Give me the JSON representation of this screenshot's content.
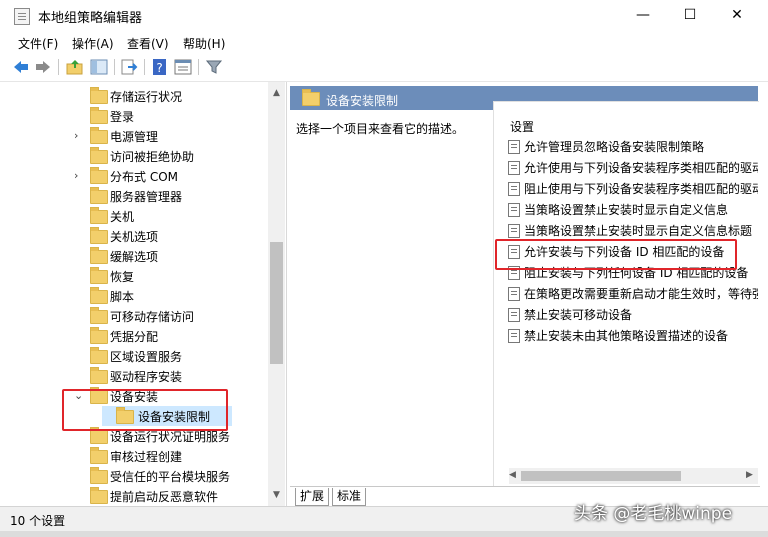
{
  "window": {
    "title": "本地组策略编辑器",
    "minimize": "—",
    "maximize": "☐",
    "close": "✕"
  },
  "menu": [
    "文件(F)",
    "操作(A)",
    "查看(V)",
    "帮助(H)"
  ],
  "toolbar": [
    "back-icon",
    "forward-icon",
    "up-folder-icon",
    "show-tree-icon",
    "export-icon",
    "help-icon",
    "properties-icon",
    "filter-icon"
  ],
  "tree": {
    "items": [
      {
        "label": "存储运行状况",
        "expandable": false
      },
      {
        "label": "登录",
        "expandable": false
      },
      {
        "label": "电源管理",
        "expandable": true
      },
      {
        "label": "访问被拒绝协助",
        "expandable": false
      },
      {
        "label": "分布式 COM",
        "expandable": true
      },
      {
        "label": "服务器管理器",
        "expandable": false
      },
      {
        "label": "关机",
        "expandable": false
      },
      {
        "label": "关机选项",
        "expandable": false
      },
      {
        "label": "缓解选项",
        "expandable": false
      },
      {
        "label": "恢复",
        "expandable": false
      },
      {
        "label": "脚本",
        "expandable": false
      },
      {
        "label": "可移动存储访问",
        "expandable": false
      },
      {
        "label": "凭据分配",
        "expandable": false
      },
      {
        "label": "区域设置服务",
        "expandable": false
      },
      {
        "label": "驱动程序安装",
        "expandable": false
      },
      {
        "label": "设备安装",
        "expandable": true,
        "expanded": true
      },
      {
        "label": "设备安装限制",
        "child": true,
        "selected": true
      },
      {
        "label": "设备运行状况证明服务",
        "expandable": false
      },
      {
        "label": "审核过程创建",
        "expandable": false
      },
      {
        "label": "受信任的平台模块服务",
        "expandable": false
      },
      {
        "label": "提前启动反恶意软件",
        "expandable": false
      }
    ]
  },
  "details": {
    "header": "设备安装限制",
    "description": "选择一个项目来查看它的描述。",
    "column": "设置",
    "settings": [
      "允许管理员忽略设备安装限制策略",
      "允许使用与下列设备安装程序类相匹配的驱动程序安装设备",
      "阻止使用与下列设备安装程序类相匹配的驱动程序安装设备",
      "当策略设置禁止安装时显示自定义信息",
      "当策略设置禁止安装时显示自定义信息标题",
      "允许安装与下列设备 ID 相匹配的设备",
      "阻止安装与下列任何设备 ID 相匹配的设备",
      "在策略更改需要重新启动才能生效时，等待强制重新启动的时间",
      "禁止安装可移动设备",
      "禁止安装未由其他策略设置描述的设备"
    ]
  },
  "tabs": [
    "扩展",
    "标准"
  ],
  "status": "10 个设置",
  "watermark": "头条 @老毛桃winpe"
}
